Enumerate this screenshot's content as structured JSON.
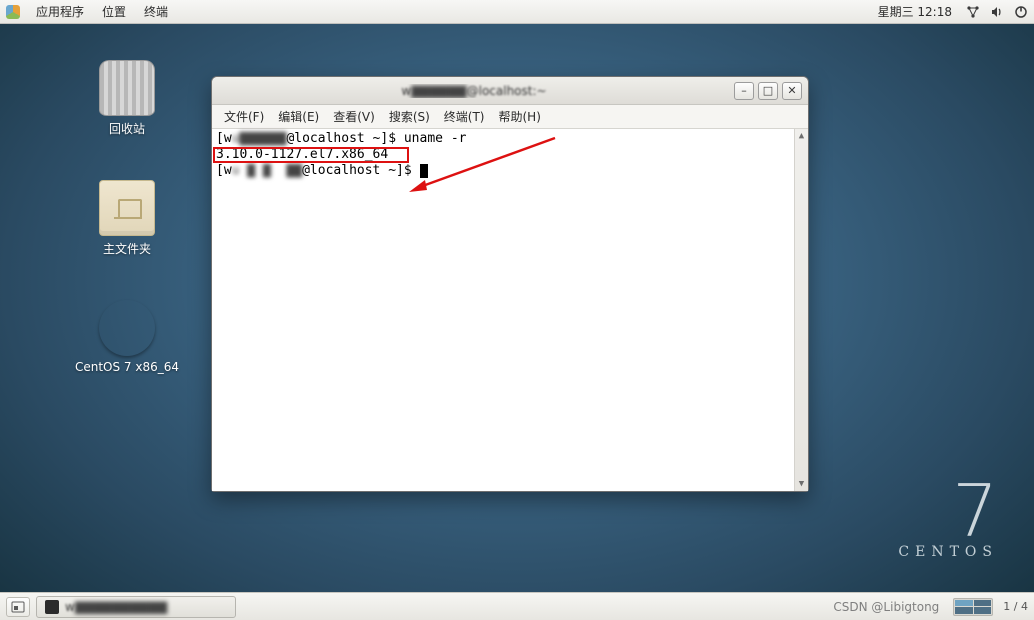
{
  "top_panel": {
    "apps": "应用程序",
    "places": "位置",
    "terminal": "终端",
    "clock": "星期三 12:18"
  },
  "desktop": {
    "trash": "回收站",
    "home": "主文件夹",
    "disc": "CentOS 7 x86_64"
  },
  "centos_mark": {
    "seven": "7",
    "word": "CENTOS"
  },
  "window": {
    "title_prefix": "w",
    "title_mid": "@localhost:~",
    "menus": {
      "file": "文件(F)",
      "edit": "编辑(E)",
      "view": "查看(V)",
      "search": "搜索(S)",
      "terminal": "终端(T)",
      "help": "帮助(H)"
    },
    "term": {
      "line1_prefix": "[w",
      "line1_user_censored": "u▇▇▇▇▇▇",
      "line1_host": "@localhost ~]$ ",
      "line1_cmd": "uname -r",
      "line2_output": "3.10.0-1127.el7.x86_64",
      "line3_prefix": "[w",
      "line3_user_censored": "u ▇ ▇  ▇▇",
      "line3_host": "@localhost ~]$ "
    }
  },
  "bottom_panel": {
    "task_label_prefix": "w",
    "task_label_censored": "▇▇▇▇▇▇▇▇▇▇",
    "watermark": "CSDN @Libigtong",
    "page_ind": "1 / 4"
  }
}
